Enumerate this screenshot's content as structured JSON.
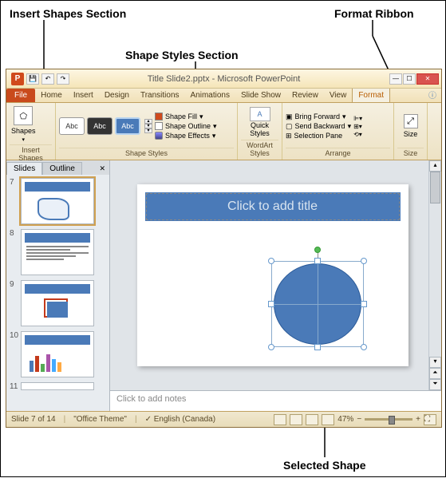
{
  "annotations": {
    "insert_shapes": "Insert Shapes Section",
    "shape_styles": "Shape Styles Section",
    "format_ribbon": "Format Ribbon",
    "selected_shape": "Selected Shape"
  },
  "titlebar": {
    "title": "Title Slide2.pptx - Microsoft PowerPoint"
  },
  "tabs": {
    "file": "File",
    "home": "Home",
    "insert": "Insert",
    "design": "Design",
    "transitions": "Transitions",
    "animations": "Animations",
    "slideshow": "Slide Show",
    "review": "Review",
    "view": "View",
    "format": "Format"
  },
  "ribbon": {
    "insert_shapes": {
      "shapes_btn": "Shapes",
      "label": "Insert Shapes"
    },
    "shape_styles": {
      "sample_text": "Abc",
      "fill": "Shape Fill",
      "outline": "Shape Outline",
      "effects": "Shape Effects",
      "label": "Shape Styles"
    },
    "wordart": {
      "quick": "Quick",
      "styles": "Styles",
      "label": "WordArt Styles"
    },
    "arrange": {
      "forward": "Bring Forward",
      "backward": "Send Backward",
      "pane": "Selection Pane",
      "label": "Arrange"
    },
    "size": {
      "btn": "Size",
      "label": "Size"
    }
  },
  "side": {
    "slides_tab": "Slides",
    "outline_tab": "Outline",
    "thumbs": [
      "7",
      "8",
      "9",
      "10",
      "11"
    ]
  },
  "slide": {
    "title_placeholder": "Click to add title"
  },
  "notes": {
    "placeholder": "Click to add notes"
  },
  "status": {
    "slide_info": "Slide 7 of 14",
    "theme": "\"Office Theme\"",
    "lang": "English (Canada)",
    "zoom": "47%"
  }
}
